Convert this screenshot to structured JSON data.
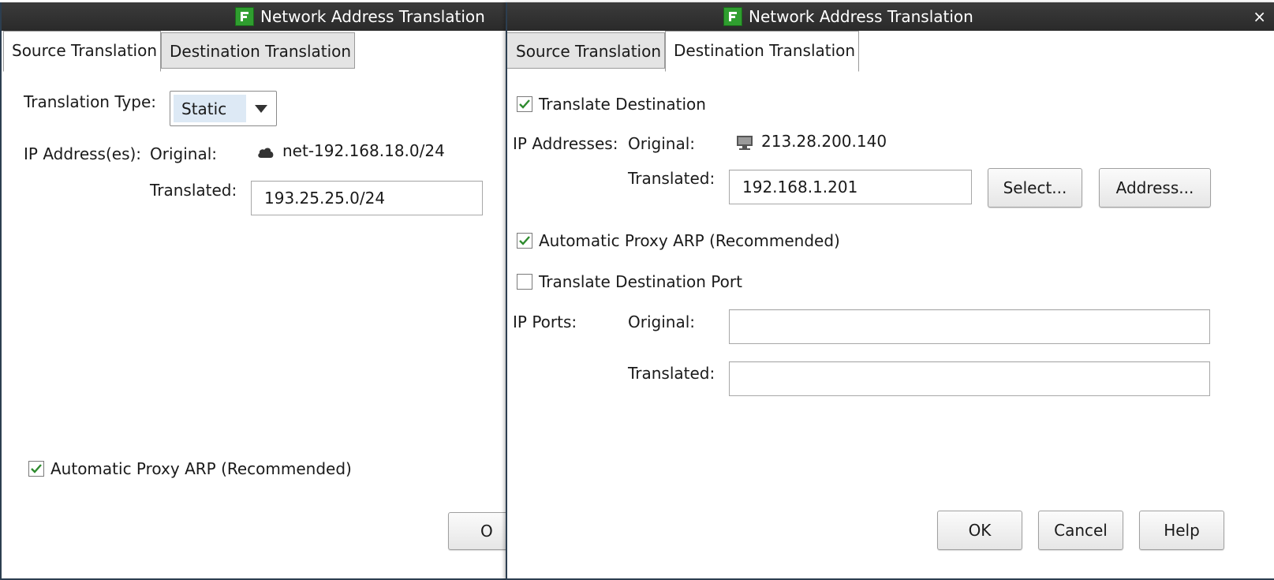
{
  "left_window": {
    "title": "Network Address Translation",
    "tabs": [
      {
        "label": "Source Translation",
        "active": true
      },
      {
        "label": "Destination Translation",
        "active": false
      }
    ],
    "translation_type_label": "Translation Type:",
    "translation_type_value": "Static",
    "ip_label": "IP Address(es):",
    "original_label": "Original:",
    "original_value": "net-192.168.18.0/24",
    "original_icon": "cloud-icon",
    "translated_label": "Translated:",
    "translated_value": "193.25.25.0/24",
    "proxy_arp_label": "Automatic Proxy ARP (Recommended)",
    "proxy_arp_checked": true,
    "ok_partial": "O"
  },
  "right_window": {
    "title": "Network Address Translation",
    "close_label": "×",
    "tabs": [
      {
        "label": "Source Translation",
        "active": false
      },
      {
        "label": "Destination Translation",
        "active": true
      }
    ],
    "translate_destination_label": "Translate Destination",
    "translate_destination_checked": true,
    "ip_addresses_label": "IP Addresses:",
    "original_label": "Original:",
    "original_value": "213.28.200.140",
    "original_icon": "computer-icon",
    "translated_label": "Translated:",
    "translated_value": "192.168.1.201",
    "select_button": "Select...",
    "address_button": "Address...",
    "proxy_arp_label": "Automatic Proxy ARP (Recommended)",
    "proxy_arp_checked": true,
    "translate_port_label": "Translate Destination Port",
    "translate_port_checked": false,
    "ip_ports_label": "IP Ports:",
    "ports_original_label": "Original:",
    "ports_original_value": "",
    "ports_translated_label": "Translated:",
    "ports_translated_value": "",
    "ok_button": "OK",
    "cancel_button": "Cancel",
    "help_button": "Help"
  },
  "colors": {
    "titlebar": "#2a2a2a",
    "accent_icon": "#2f9e2f",
    "check": "#2e8b2e",
    "selection": "#dde9f5"
  }
}
